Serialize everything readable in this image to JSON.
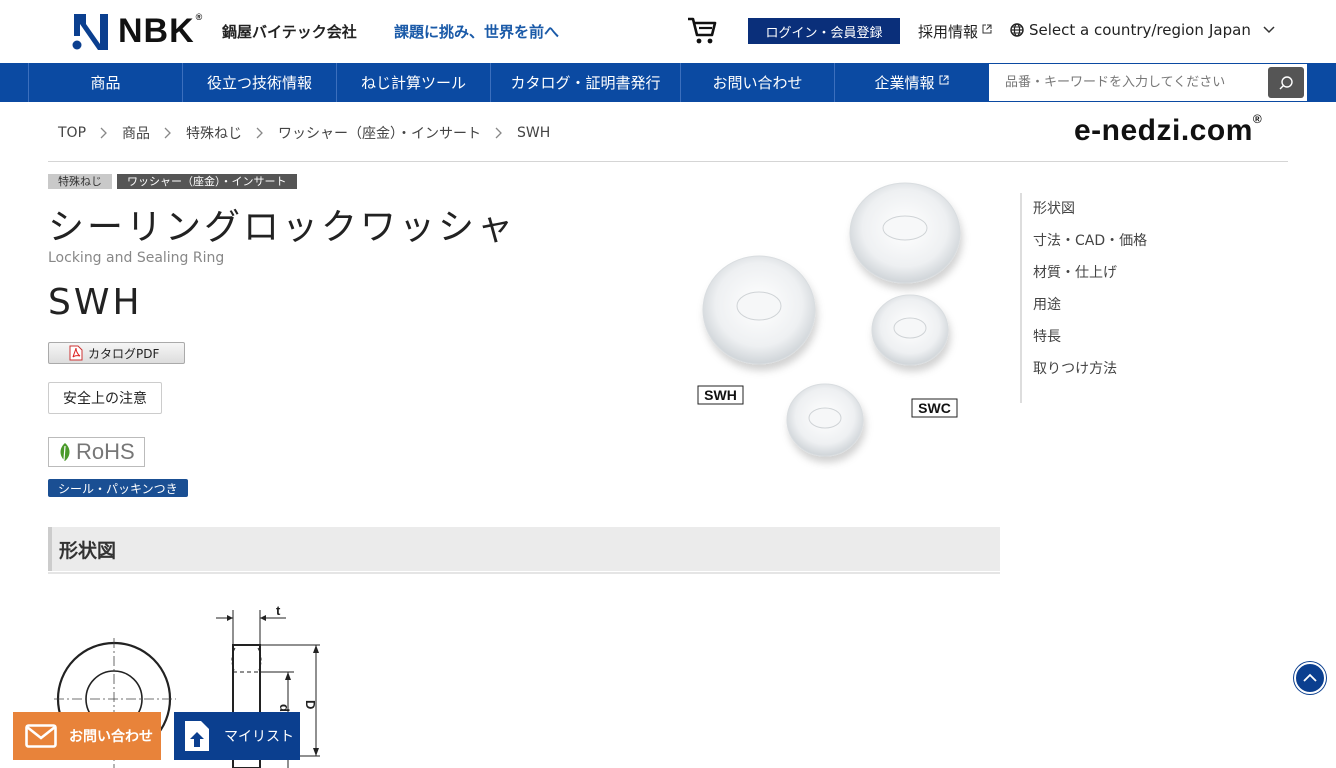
{
  "header": {
    "logo_text": "NBK",
    "company_name": "鍋屋バイテック会社",
    "slogan": "課題に挑み、世界を前へ",
    "login_label": "ログイン・会員登録",
    "recruit_label": "採用情報",
    "region_label": "Select a country/region",
    "country_label": "Japan"
  },
  "nav": {
    "items": [
      {
        "label": "商品"
      },
      {
        "label": "役立つ技術情報"
      },
      {
        "label": "ねじ計算ツール"
      },
      {
        "label": "カタログ・証明書発行"
      },
      {
        "label": "お問い合わせ"
      },
      {
        "label": "企業情報"
      }
    ],
    "search_placeholder": "品番・キーワードを入力してください"
  },
  "breadcrumb": [
    "TOP",
    "商品",
    "特殊ねじ",
    "ワッシャー（座金）・インサート",
    "SWH"
  ],
  "brand_logo": "e-nedzi.com",
  "product": {
    "tags": [
      "特殊ねじ",
      "ワッシャー（座金）・インサート"
    ],
    "title": "シーリングロックワッシャ",
    "subtitle": "Locking and Sealing Ring",
    "code": "SWH",
    "pdf_label": "カタログPDF",
    "safety_label": "安全上の注意",
    "rohs_label": "RoHS",
    "feature_tag": "シール・パッキンつき",
    "image_labels": [
      "SWH",
      "SWC"
    ]
  },
  "side_nav": [
    "形状図",
    "寸法・CAD・価格",
    "材質・仕上げ",
    "用途",
    "特長",
    "取りつけ方法"
  ],
  "section": {
    "title": "形状図",
    "dim_labels": [
      "t",
      "d",
      "D"
    ]
  },
  "floating": {
    "contact_label": "お問い合わせ",
    "mylist_label": "マイリスト"
  },
  "colors": {
    "nav_blue": "#0b4aa2",
    "login_blue": "#0a2f7a",
    "contact_orange": "#e8833a",
    "slogan_blue": "#1a5aa8"
  }
}
